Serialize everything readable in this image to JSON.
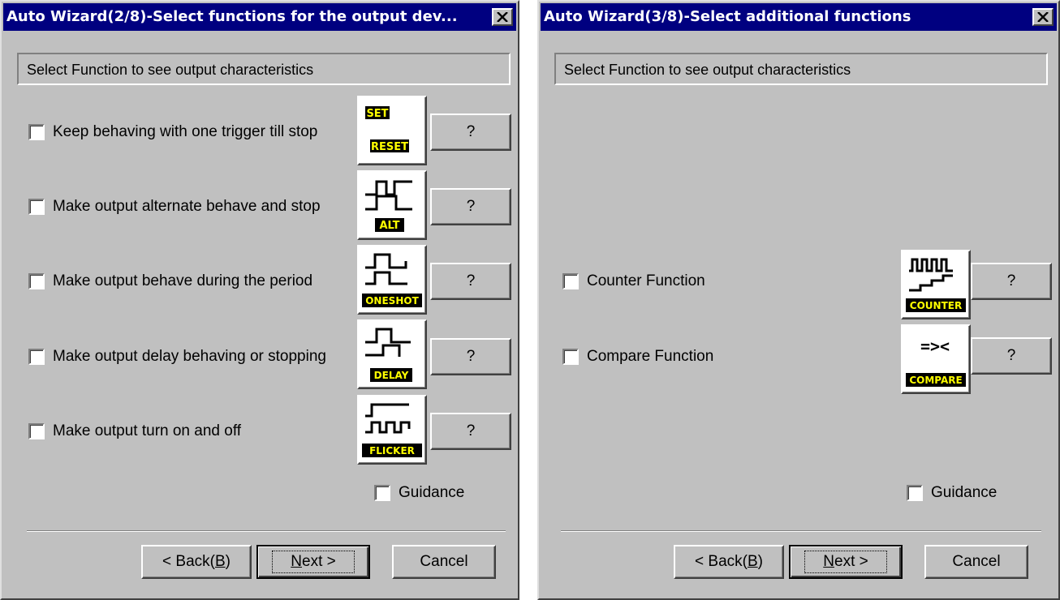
{
  "dialog1": {
    "title": "Auto Wizard(2/8)-Select functions for the output dev...",
    "info_text": "Select Function to see output characteristics",
    "options": [
      {
        "label": "Keep behaving with one trigger till stop",
        "icon": "set-reset-icon",
        "icon_text": [
          "SET",
          "RESET"
        ],
        "help": "?"
      },
      {
        "label": "Make output alternate behave and stop",
        "icon": "alt-icon",
        "icon_text": [
          "ALT"
        ],
        "help": "?"
      },
      {
        "label": "Make output behave during the period",
        "icon": "oneshot-icon",
        "icon_text": [
          "ONESHOT"
        ],
        "help": "?"
      },
      {
        "label": "Make output delay behaving or stopping",
        "icon": "delay-icon",
        "icon_text": [
          "DELAY"
        ],
        "help": "?"
      },
      {
        "label": "Make output turn on and off",
        "icon": "flicker-icon",
        "icon_text": [
          "FLICKER"
        ],
        "help": "?"
      }
    ],
    "guidance": "Guidance",
    "buttons": {
      "back_pre": "< Back(",
      "back_key": "B",
      "back_post": ")",
      "next_key": "N",
      "next_post": "ext >",
      "cancel": "Cancel"
    }
  },
  "dialog2": {
    "title": "Auto Wizard(3/8)-Select additional functions",
    "info_text": "Select Function to see output characteristics",
    "options": [
      {
        "label": "Counter Function",
        "icon": "counter-icon",
        "icon_text": [
          "COUNTER"
        ],
        "help": "?"
      },
      {
        "label": "Compare Function",
        "icon": "compare-icon",
        "icon_text": [
          "=><",
          "COMPARE"
        ],
        "help": "?"
      }
    ],
    "guidance": "Guidance",
    "buttons": {
      "back_pre": "< Back(",
      "back_key": "B",
      "back_post": ")",
      "next_key": "N",
      "next_post": "ext >",
      "cancel": "Cancel"
    }
  },
  "colors": {
    "titlebar": "#000080",
    "face": "#c0c0c0",
    "label_yellow": "#ffff00"
  }
}
